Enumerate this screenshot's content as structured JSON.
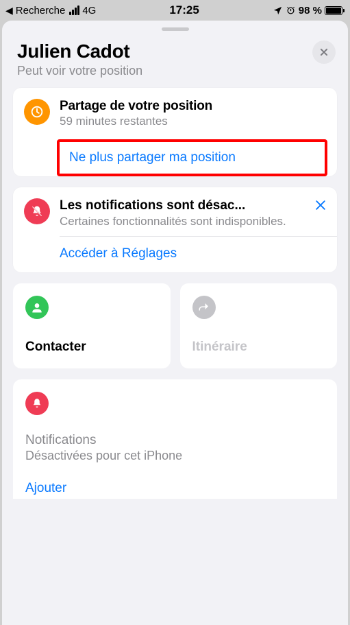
{
  "status": {
    "back_app": "Recherche",
    "network": "4G",
    "time": "17:25",
    "battery_pct": "98 %"
  },
  "header": {
    "title": "Julien Cadot",
    "subtitle": "Peut voir votre position"
  },
  "sharing": {
    "title": "Partage de votre position",
    "remaining": "59 minutes restantes",
    "stop_label": "Ne plus partager ma position"
  },
  "notif_banner": {
    "title": "Les notifications sont désac...",
    "body": "Certaines fonctionnalités sont indisponibles.",
    "settings_link": "Accéder à Réglages"
  },
  "tiles": {
    "contact": "Contacter",
    "directions": "Itinéraire"
  },
  "notifications": {
    "heading": "Notifications",
    "status": "Désactivées pour cet iPhone",
    "add": "Ajouter"
  },
  "colors": {
    "link": "#0a7aff",
    "orange": "#ff9500",
    "red": "#ef3c55",
    "green": "#32c558",
    "gray": "#c4c4c8"
  }
}
